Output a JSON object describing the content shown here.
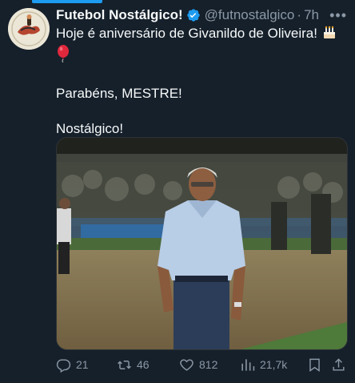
{
  "tweet": {
    "author_name": "Futebol Nostálgico!",
    "handle": "@futnostalgico",
    "separator": "·",
    "time": "7h",
    "more_label": "•••",
    "text_line1": "Hoje é aniversário de Givanildo de Oliveira!",
    "text_line2": "Parabéns, MESTRE!",
    "text_line3": "Nostálgico!"
  },
  "actions": {
    "replies": "21",
    "retweets": "46",
    "likes": "812",
    "views": "21,7k"
  },
  "colors": {
    "background": "#15202b",
    "accent": "#1d9bf0",
    "muted": "#8b98a5",
    "text": "#f7f9f9"
  },
  "icons": {
    "verified": "verified-badge-icon",
    "cake": "birthday-cake-icon",
    "balloon": "balloon-icon",
    "more": "more-icon",
    "reply": "reply-icon",
    "retweet": "retweet-icon",
    "like": "heart-icon",
    "views": "views-icon",
    "bookmark": "bookmark-icon",
    "share": "share-icon"
  }
}
